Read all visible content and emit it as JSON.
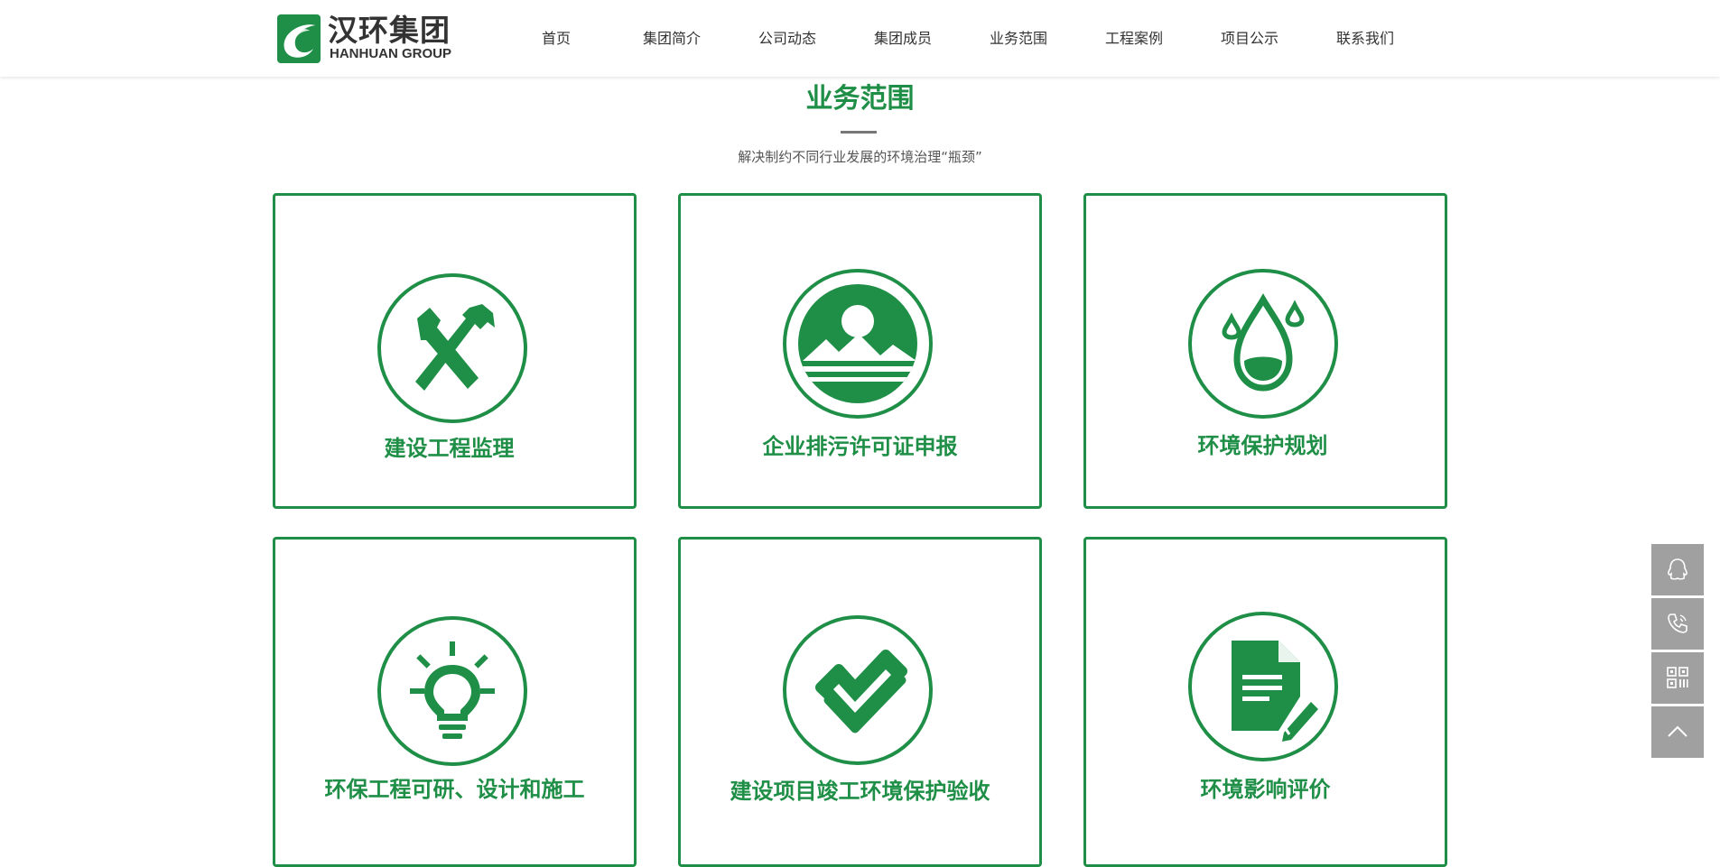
{
  "header": {
    "logo_cn": "汉环集团",
    "logo_en": "HANHUAN GROUP",
    "nav": [
      "首页",
      "集团简介",
      "公司动态",
      "集团成员",
      "业务范围",
      "工程案例",
      "项目公示",
      "联系我们"
    ]
  },
  "section": {
    "title": "业务范围",
    "subtitle": "解决制约不同行业发展的环境治理“瓶颈”"
  },
  "cards": [
    {
      "label": "建设工程监理",
      "icon": "tools-icon"
    },
    {
      "label": "企业排污许可证申报",
      "icon": "landscape-icon"
    },
    {
      "label": "环境保护规划",
      "icon": "water-drop-icon"
    },
    {
      "label": "环保工程可研、设计和施工",
      "icon": "lightbulb-icon"
    },
    {
      "label": "建设项目竣工环境保护验收",
      "icon": "check-icon"
    },
    {
      "label": "环境影响评价",
      "icon": "document-edit-icon"
    }
  ],
  "floating": [
    "qq-icon",
    "phone-icon",
    "qrcode-icon",
    "back-to-top-icon"
  ],
  "colors": {
    "brand_green": "#1f8f47",
    "float_gray": "#a0a0a0"
  }
}
